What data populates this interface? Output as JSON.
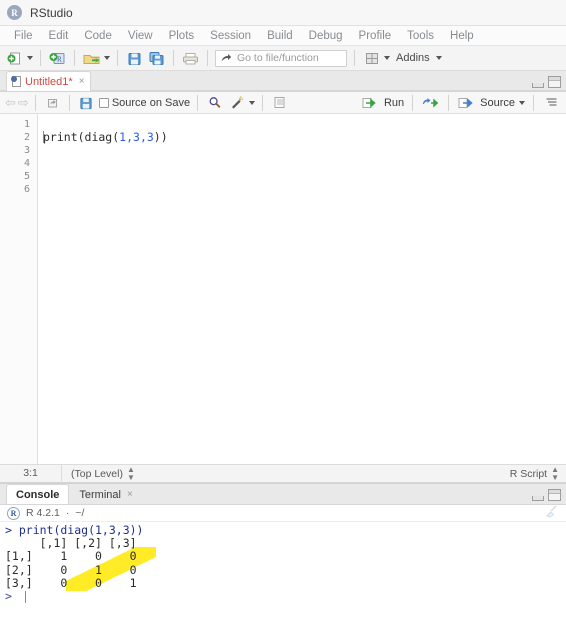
{
  "window": {
    "title": "RStudio",
    "logo_letter": "R"
  },
  "menubar": {
    "items": [
      "File",
      "Edit",
      "Code",
      "View",
      "Plots",
      "Session",
      "Build",
      "Debug",
      "Profile",
      "Tools",
      "Help"
    ]
  },
  "toolbar": {
    "new_file_icon": "new-file-icon",
    "new_project_icon": "new-project-icon",
    "open_file_icon": "open-folder-icon",
    "save_icon": "save-icon",
    "save_all_icon": "save-all-icon",
    "print_icon": "print-icon",
    "goto_placeholder": "Go to file/function",
    "panes_icon": "workspace-panes-icon",
    "addins_label": "Addins"
  },
  "source": {
    "tab": {
      "name": "Untitled1*",
      "close": "×"
    },
    "toolbar": {
      "back_icon": "back-arrow-icon",
      "forward_icon": "forward-arrow-icon",
      "popout_icon": "show-in-new-window-icon",
      "save_icon": "save-icon",
      "source_on_save_label": "Source on Save",
      "find_icon": "find-replace-icon",
      "wand_icon": "code-tools-icon",
      "outline_icon": "document-outline-icon",
      "run_label": "Run",
      "rerun_icon": "re-run-icon",
      "source_label": "Source",
      "outline_toggle_icon": "outline-toggle-icon"
    },
    "line_numbers": [
      "1",
      "2",
      "3",
      "4",
      "5",
      "6"
    ],
    "code_lines": [
      {
        "num": 1,
        "text": ""
      },
      {
        "num": 2,
        "prefix": "print(diag(",
        "args": "1,3,3",
        "suffix": "))"
      },
      {
        "num": 3,
        "text": ""
      },
      {
        "num": 4,
        "text": ""
      },
      {
        "num": 5,
        "text": ""
      },
      {
        "num": 6,
        "text": ""
      }
    ],
    "code_line2_full": "print(diag(1,3,3))"
  },
  "statusbar": {
    "cursor_position": "3:1",
    "scope": "(Top Level)",
    "file_type": "R Script"
  },
  "console": {
    "tabs": [
      {
        "label": "Console",
        "active": true
      },
      {
        "label": "Terminal",
        "active": false,
        "close": "×"
      }
    ],
    "version_line": "R 4.2.1",
    "separator": "·",
    "working_dir": "~/",
    "clear_icon": "broom-clear-icon",
    "output": [
      {
        "type": "command",
        "text": "> print(diag(1,3,3))"
      },
      {
        "type": "output",
        "text": "     [,1] [,2] [,3]"
      },
      {
        "type": "output",
        "text": "[1,]    1    0    0"
      },
      {
        "type": "output",
        "text": "[2,]    0    1    0"
      },
      {
        "type": "output",
        "text": "[3,]    0    0    1"
      },
      {
        "type": "output",
        "text": "> "
      }
    ],
    "highlight": {
      "color": "#ffe800",
      "description": "yellow-diagonal-marker-over-matrix-diagonal"
    }
  },
  "colors": {
    "accent_blue": "#2b5fd9",
    "tab_modified_red": "#d04a3d",
    "highlight_yellow": "#ffe800",
    "console_command_blue": "#1f2f8f"
  }
}
